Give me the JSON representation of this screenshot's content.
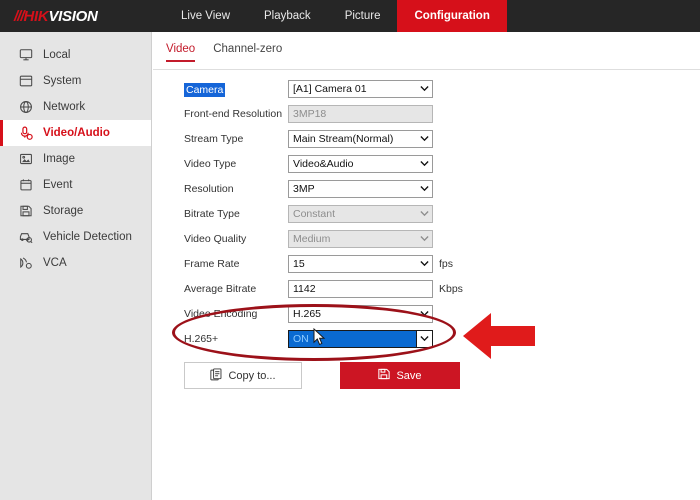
{
  "brand": {
    "logo_bars": "///",
    "logo_hik": "HIK",
    "logo_vision": "VISION"
  },
  "topnav": {
    "items": [
      {
        "label": "Live View",
        "active": false
      },
      {
        "label": "Playback",
        "active": false
      },
      {
        "label": "Picture",
        "active": false
      },
      {
        "label": "Configuration",
        "active": true
      }
    ]
  },
  "sidebar": {
    "items": [
      {
        "label": "Local",
        "icon": "monitor-icon",
        "active": false
      },
      {
        "label": "System",
        "icon": "window-icon",
        "active": false
      },
      {
        "label": "Network",
        "icon": "globe-icon",
        "active": false
      },
      {
        "label": "Video/Audio",
        "icon": "audio-video-icon",
        "active": true
      },
      {
        "label": "Image",
        "icon": "picture-icon",
        "active": false
      },
      {
        "label": "Event",
        "icon": "calendar-icon",
        "active": false
      },
      {
        "label": "Storage",
        "icon": "floppy-disk-icon",
        "active": false
      },
      {
        "label": "Vehicle Detection",
        "icon": "vehicle-search-icon",
        "active": false
      },
      {
        "label": "VCA",
        "icon": "vca-icon",
        "active": false
      }
    ]
  },
  "subtabs": [
    {
      "label": "Video",
      "active": true
    },
    {
      "label": "Channel-zero",
      "active": false
    }
  ],
  "form": {
    "rows": [
      {
        "label": "Camera",
        "value": "[A1] Camera 01",
        "type": "select",
        "state": "label-selected",
        "unit": ""
      },
      {
        "label": "Front-end Resolution",
        "value": "3MP18",
        "type": "text",
        "state": "disabled",
        "unit": ""
      },
      {
        "label": "Stream Type",
        "value": "Main Stream(Normal)",
        "type": "select",
        "state": "normal",
        "unit": ""
      },
      {
        "label": "Video Type",
        "value": "Video&Audio",
        "type": "select",
        "state": "normal",
        "unit": ""
      },
      {
        "label": "Resolution",
        "value": "3MP",
        "type": "select",
        "state": "normal",
        "unit": ""
      },
      {
        "label": "Bitrate Type",
        "value": "Constant",
        "type": "select",
        "state": "disabled",
        "unit": ""
      },
      {
        "label": "Video Quality",
        "value": "Medium",
        "type": "select",
        "state": "disabled",
        "unit": ""
      },
      {
        "label": "Frame Rate",
        "value": "15",
        "type": "select",
        "state": "normal",
        "unit": "fps"
      },
      {
        "label": "Average Bitrate",
        "value": "1142",
        "type": "text",
        "state": "normal",
        "unit": "Kbps"
      },
      {
        "label": "Video Encoding",
        "value": "H.265",
        "type": "select",
        "state": "normal",
        "unit": ""
      },
      {
        "label": "H.265+",
        "value": "ON",
        "type": "select",
        "state": "focused",
        "unit": ""
      }
    ]
  },
  "buttons": {
    "copy_to": "Copy to...",
    "save": "Save"
  },
  "colors": {
    "brand_red": "#d6101a",
    "save_red": "#cc1523",
    "annotation_red": "#e01b1b",
    "ellipse_red": "#9c1119",
    "focus_blue": "#0a6ad1",
    "selection_blue": "#1565d8",
    "topbar_dark": "#262626",
    "sidebar_grey": "#e5e5e5"
  }
}
